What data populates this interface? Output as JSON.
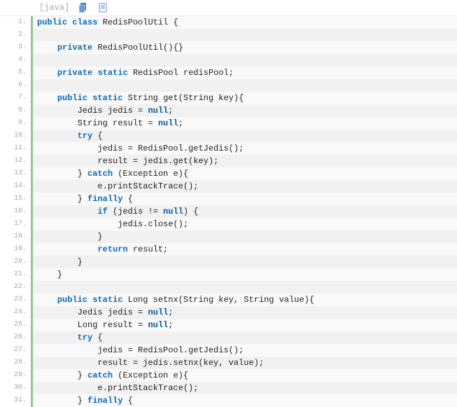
{
  "header": {
    "language_label": "[java]",
    "copy_icon_name": "copy-icon",
    "view_icon_name": "view-icon"
  },
  "lines": [
    {
      "n": "1.",
      "tokens": [
        {
          "t": "public",
          "c": "kw"
        },
        {
          "t": " ",
          "c": "plain"
        },
        {
          "t": "class",
          "c": "kw"
        },
        {
          "t": " RedisPoolUtil {",
          "c": "plain"
        }
      ]
    },
    {
      "n": "2.",
      "tokens": []
    },
    {
      "n": "3.",
      "tokens": [
        {
          "t": "    ",
          "c": "plain"
        },
        {
          "t": "private",
          "c": "kw"
        },
        {
          "t": " RedisPoolUtil(){}",
          "c": "plain"
        }
      ]
    },
    {
      "n": "4.",
      "tokens": []
    },
    {
      "n": "5.",
      "tokens": [
        {
          "t": "    ",
          "c": "plain"
        },
        {
          "t": "private",
          "c": "kw"
        },
        {
          "t": " ",
          "c": "plain"
        },
        {
          "t": "static",
          "c": "kw"
        },
        {
          "t": " RedisPool redisPool;",
          "c": "plain"
        }
      ]
    },
    {
      "n": "6.",
      "tokens": []
    },
    {
      "n": "7.",
      "tokens": [
        {
          "t": "    ",
          "c": "plain"
        },
        {
          "t": "public",
          "c": "kw"
        },
        {
          "t": " ",
          "c": "plain"
        },
        {
          "t": "static",
          "c": "kw"
        },
        {
          "t": " String get(String key){",
          "c": "plain"
        }
      ]
    },
    {
      "n": "8.",
      "tokens": [
        {
          "t": "        Jedis jedis = ",
          "c": "plain"
        },
        {
          "t": "null",
          "c": "null"
        },
        {
          "t": ";",
          "c": "plain"
        }
      ]
    },
    {
      "n": "9.",
      "tokens": [
        {
          "t": "        String result = ",
          "c": "plain"
        },
        {
          "t": "null",
          "c": "null"
        },
        {
          "t": ";",
          "c": "plain"
        }
      ]
    },
    {
      "n": "10.",
      "tokens": [
        {
          "t": "        ",
          "c": "plain"
        },
        {
          "t": "try",
          "c": "kw"
        },
        {
          "t": " {",
          "c": "plain"
        }
      ]
    },
    {
      "n": "11.",
      "tokens": [
        {
          "t": "            jedis = RedisPool.getJedis();",
          "c": "plain"
        }
      ]
    },
    {
      "n": "12.",
      "tokens": [
        {
          "t": "            result = jedis.get(key);",
          "c": "plain"
        }
      ]
    },
    {
      "n": "13.",
      "tokens": [
        {
          "t": "        } ",
          "c": "plain"
        },
        {
          "t": "catch",
          "c": "kw"
        },
        {
          "t": " (Exception e){",
          "c": "plain"
        }
      ]
    },
    {
      "n": "14.",
      "tokens": [
        {
          "t": "            e.printStackTrace();",
          "c": "plain"
        }
      ]
    },
    {
      "n": "15.",
      "tokens": [
        {
          "t": "        } ",
          "c": "plain"
        },
        {
          "t": "finally",
          "c": "kw"
        },
        {
          "t": " {",
          "c": "plain"
        }
      ]
    },
    {
      "n": "16.",
      "tokens": [
        {
          "t": "            ",
          "c": "plain"
        },
        {
          "t": "if",
          "c": "kw"
        },
        {
          "t": " (jedis != ",
          "c": "plain"
        },
        {
          "t": "null",
          "c": "null"
        },
        {
          "t": ") {",
          "c": "plain"
        }
      ]
    },
    {
      "n": "17.",
      "tokens": [
        {
          "t": "                jedis.close();",
          "c": "plain"
        }
      ]
    },
    {
      "n": "18.",
      "tokens": [
        {
          "t": "            }",
          "c": "plain"
        }
      ]
    },
    {
      "n": "19.",
      "tokens": [
        {
          "t": "            ",
          "c": "plain"
        },
        {
          "t": "return",
          "c": "kw"
        },
        {
          "t": " result;",
          "c": "plain"
        }
      ]
    },
    {
      "n": "20.",
      "tokens": [
        {
          "t": "        }",
          "c": "plain"
        }
      ]
    },
    {
      "n": "21.",
      "tokens": [
        {
          "t": "    }",
          "c": "plain"
        }
      ]
    },
    {
      "n": "22.",
      "tokens": []
    },
    {
      "n": "23.",
      "tokens": [
        {
          "t": "    ",
          "c": "plain"
        },
        {
          "t": "public",
          "c": "kw"
        },
        {
          "t": " ",
          "c": "plain"
        },
        {
          "t": "static",
          "c": "kw"
        },
        {
          "t": " Long setnx(String key, String value){",
          "c": "plain"
        }
      ]
    },
    {
      "n": "24.",
      "tokens": [
        {
          "t": "        Jedis jedis = ",
          "c": "plain"
        },
        {
          "t": "null",
          "c": "null"
        },
        {
          "t": ";",
          "c": "plain"
        }
      ]
    },
    {
      "n": "25.",
      "tokens": [
        {
          "t": "        Long result = ",
          "c": "plain"
        },
        {
          "t": "null",
          "c": "null"
        },
        {
          "t": ";",
          "c": "plain"
        }
      ]
    },
    {
      "n": "26.",
      "tokens": [
        {
          "t": "        ",
          "c": "plain"
        },
        {
          "t": "try",
          "c": "kw"
        },
        {
          "t": " {",
          "c": "plain"
        }
      ]
    },
    {
      "n": "27.",
      "tokens": [
        {
          "t": "            jedis = RedisPool.getJedis();",
          "c": "plain"
        }
      ]
    },
    {
      "n": "28.",
      "tokens": [
        {
          "t": "            result = jedis.setnx(key, value);",
          "c": "plain"
        }
      ]
    },
    {
      "n": "29.",
      "tokens": [
        {
          "t": "        } ",
          "c": "plain"
        },
        {
          "t": "catch",
          "c": "kw"
        },
        {
          "t": " (Exception e){",
          "c": "plain"
        }
      ]
    },
    {
      "n": "30.",
      "tokens": [
        {
          "t": "            e.printStackTrace();",
          "c": "plain"
        }
      ]
    },
    {
      "n": "31.",
      "tokens": [
        {
          "t": "        } ",
          "c": "plain"
        },
        {
          "t": "finally",
          "c": "kw"
        },
        {
          "t": " {",
          "c": "plain"
        }
      ]
    }
  ]
}
